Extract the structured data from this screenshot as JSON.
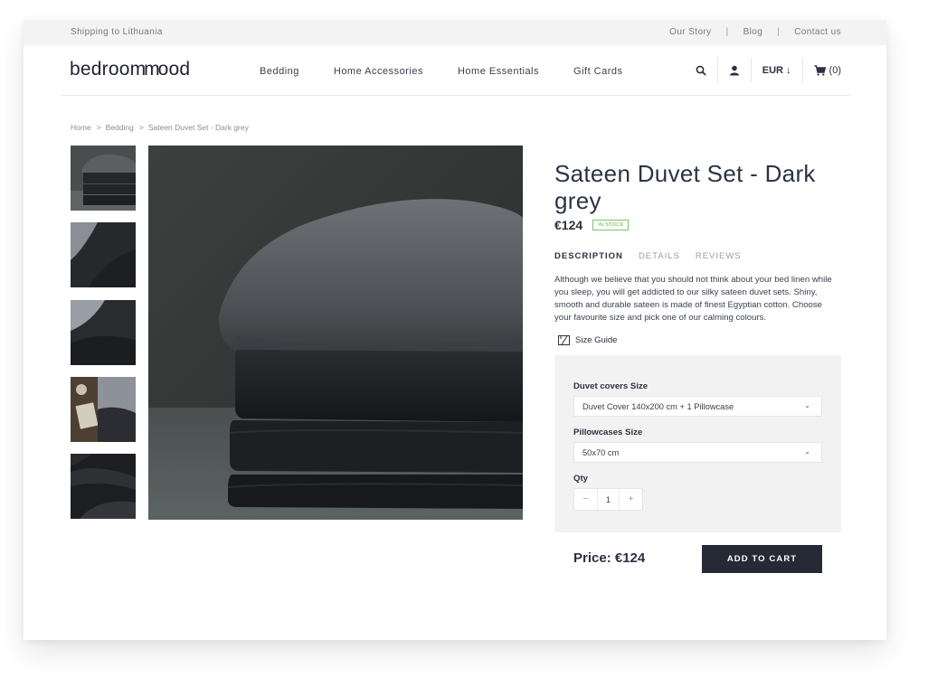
{
  "topbar": {
    "shipping_text": "Shipping to Lithuania",
    "links": [
      "Our Story",
      "Blog",
      "Contact us"
    ]
  },
  "header": {
    "logo_text_start": "bedroo",
    "logo_text_mid": "mm",
    "logo_text_end": "ood",
    "nav": [
      "Bedding",
      "Home Accessories",
      "Home Essentials",
      "Gift Cards"
    ],
    "currency": "EUR ↓",
    "cart_count": "(0)",
    "icons": [
      "search-icon",
      "user-icon",
      "cart-icon"
    ]
  },
  "breadcrumb": [
    "Home",
    "Bedding",
    "Sateen Duvet Set - Dark grey"
  ],
  "breadcrumb_sep": ">",
  "product": {
    "title": "Sateen Duvet Set - Dark grey",
    "price": "€124",
    "stock_badge": "IN STOCK",
    "tabs": [
      "DESCRIPTION",
      "DETAILS",
      "REVIEWS"
    ],
    "description": "Although we believe that you should not think about your bed linen while you sleep, you will get addicted to our silky sateen duvet sets. Shiny, smooth and durable sateen is made of finest Egyptian cotton. Choose your favourite size and pick one of our calming colours.",
    "size_guide_label": "Size Guide"
  },
  "options": {
    "duvet_label": "Duvet covers Size",
    "duvet_value": "Duvet Cover 140x200 cm + 1 Pillowcase",
    "pillow_label": "Pillowcases Size",
    "pillow_value": "50x70 cm",
    "qty_label": "Qty",
    "qty_value": "1",
    "qty_minus": "−",
    "qty_plus": "+"
  },
  "checkout": {
    "price_text": "Price: €124",
    "add_to_cart": "ADD TO CART"
  },
  "colors": {
    "accent": "#262a36",
    "stock_green": "#5aa84a",
    "panel_bg": "#f2f2f2"
  }
}
